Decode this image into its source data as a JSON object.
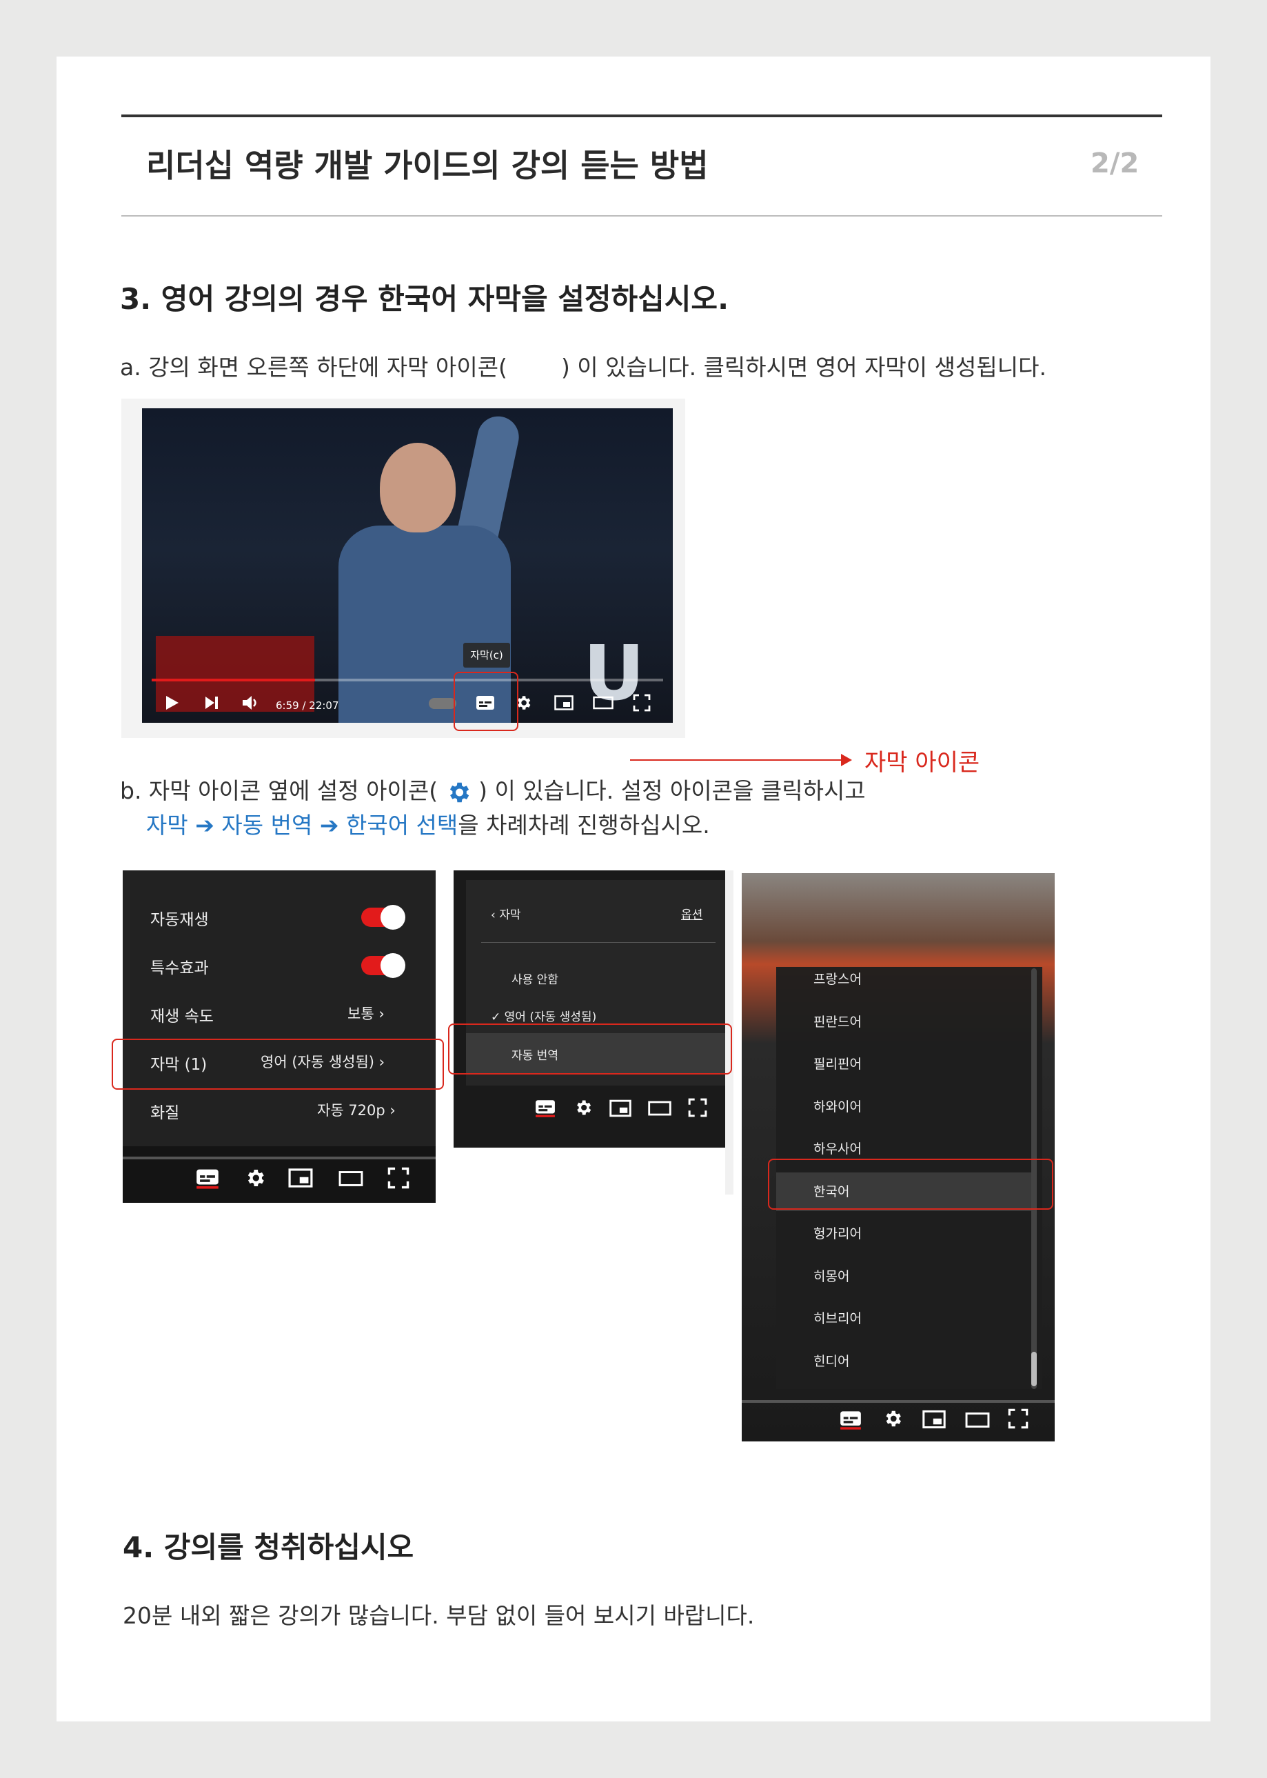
{
  "header": {
    "title": "리더십 역량 개발 가이드의 강의 듣는 방법",
    "page": "2/2"
  },
  "section3": {
    "heading": "3. 영어 강의의 경우 한국어 자막을 설정하십시오.",
    "step_a_before": "a. 강의 화면 오른쪽 하단에 자막 아이콘(",
    "step_a_after": ") 이 있습니다. 클릭하시면 영어 자막이 생성됩니다.",
    "video": {
      "time": "6:59 / 22:07",
      "tooltip": "자막(c)",
      "progress_fraction": 0.32
    },
    "annotation": "자막 아이콘",
    "step_b_line1_before": "b. 자막 아이콘 옆에 설정 아이콘(",
    "step_b_line1_after": ") 이 있습니다. 설정 아이콘을 클릭하시고",
    "step_b_path": [
      "자막",
      "자동 번역",
      "한국어 선택"
    ],
    "step_b_tail": "을 차례차례 진행하십시오.",
    "arrow_glyph": "➔",
    "settings_menu": {
      "rows": [
        {
          "label": "자동재생",
          "toggle": true
        },
        {
          "label": "특수효과",
          "toggle": true
        },
        {
          "label": "재생 속도",
          "value": "보통"
        },
        {
          "label": "자막 (1)",
          "value": "영어 (자동 생성됨)"
        },
        {
          "label": "화질",
          "value": "자동 720p"
        }
      ]
    },
    "subtitle_menu": {
      "back_label": "자막",
      "options_label": "옵션",
      "items": [
        "사용 안함",
        "영어 (자동 생성됨)",
        "자동 번역"
      ],
      "checked": "영어 (자동 생성됨)"
    },
    "language_list": [
      "프랑스어",
      "핀란드어",
      "필리핀어",
      "하와이어",
      "하우사어",
      "한국어",
      "헝가리어",
      "히몽어",
      "히브리어",
      "힌디어"
    ],
    "language_selected": "한국어"
  },
  "section4": {
    "heading": "4. 강의를 청취하십시오",
    "body": "20분 내외 짧은 강의가 많습니다. 부담 없이 들어 보시기 바랍니다."
  },
  "colors": {
    "accent_red": "#d9281d",
    "link_blue": "#2577c4",
    "toggle_red": "#e21b1b"
  },
  "icons": [
    "play-icon",
    "skip-next-icon",
    "volume-icon",
    "subtitles-icon",
    "gear-icon",
    "miniplayer-icon",
    "theater-icon",
    "fullscreen-icon"
  ]
}
